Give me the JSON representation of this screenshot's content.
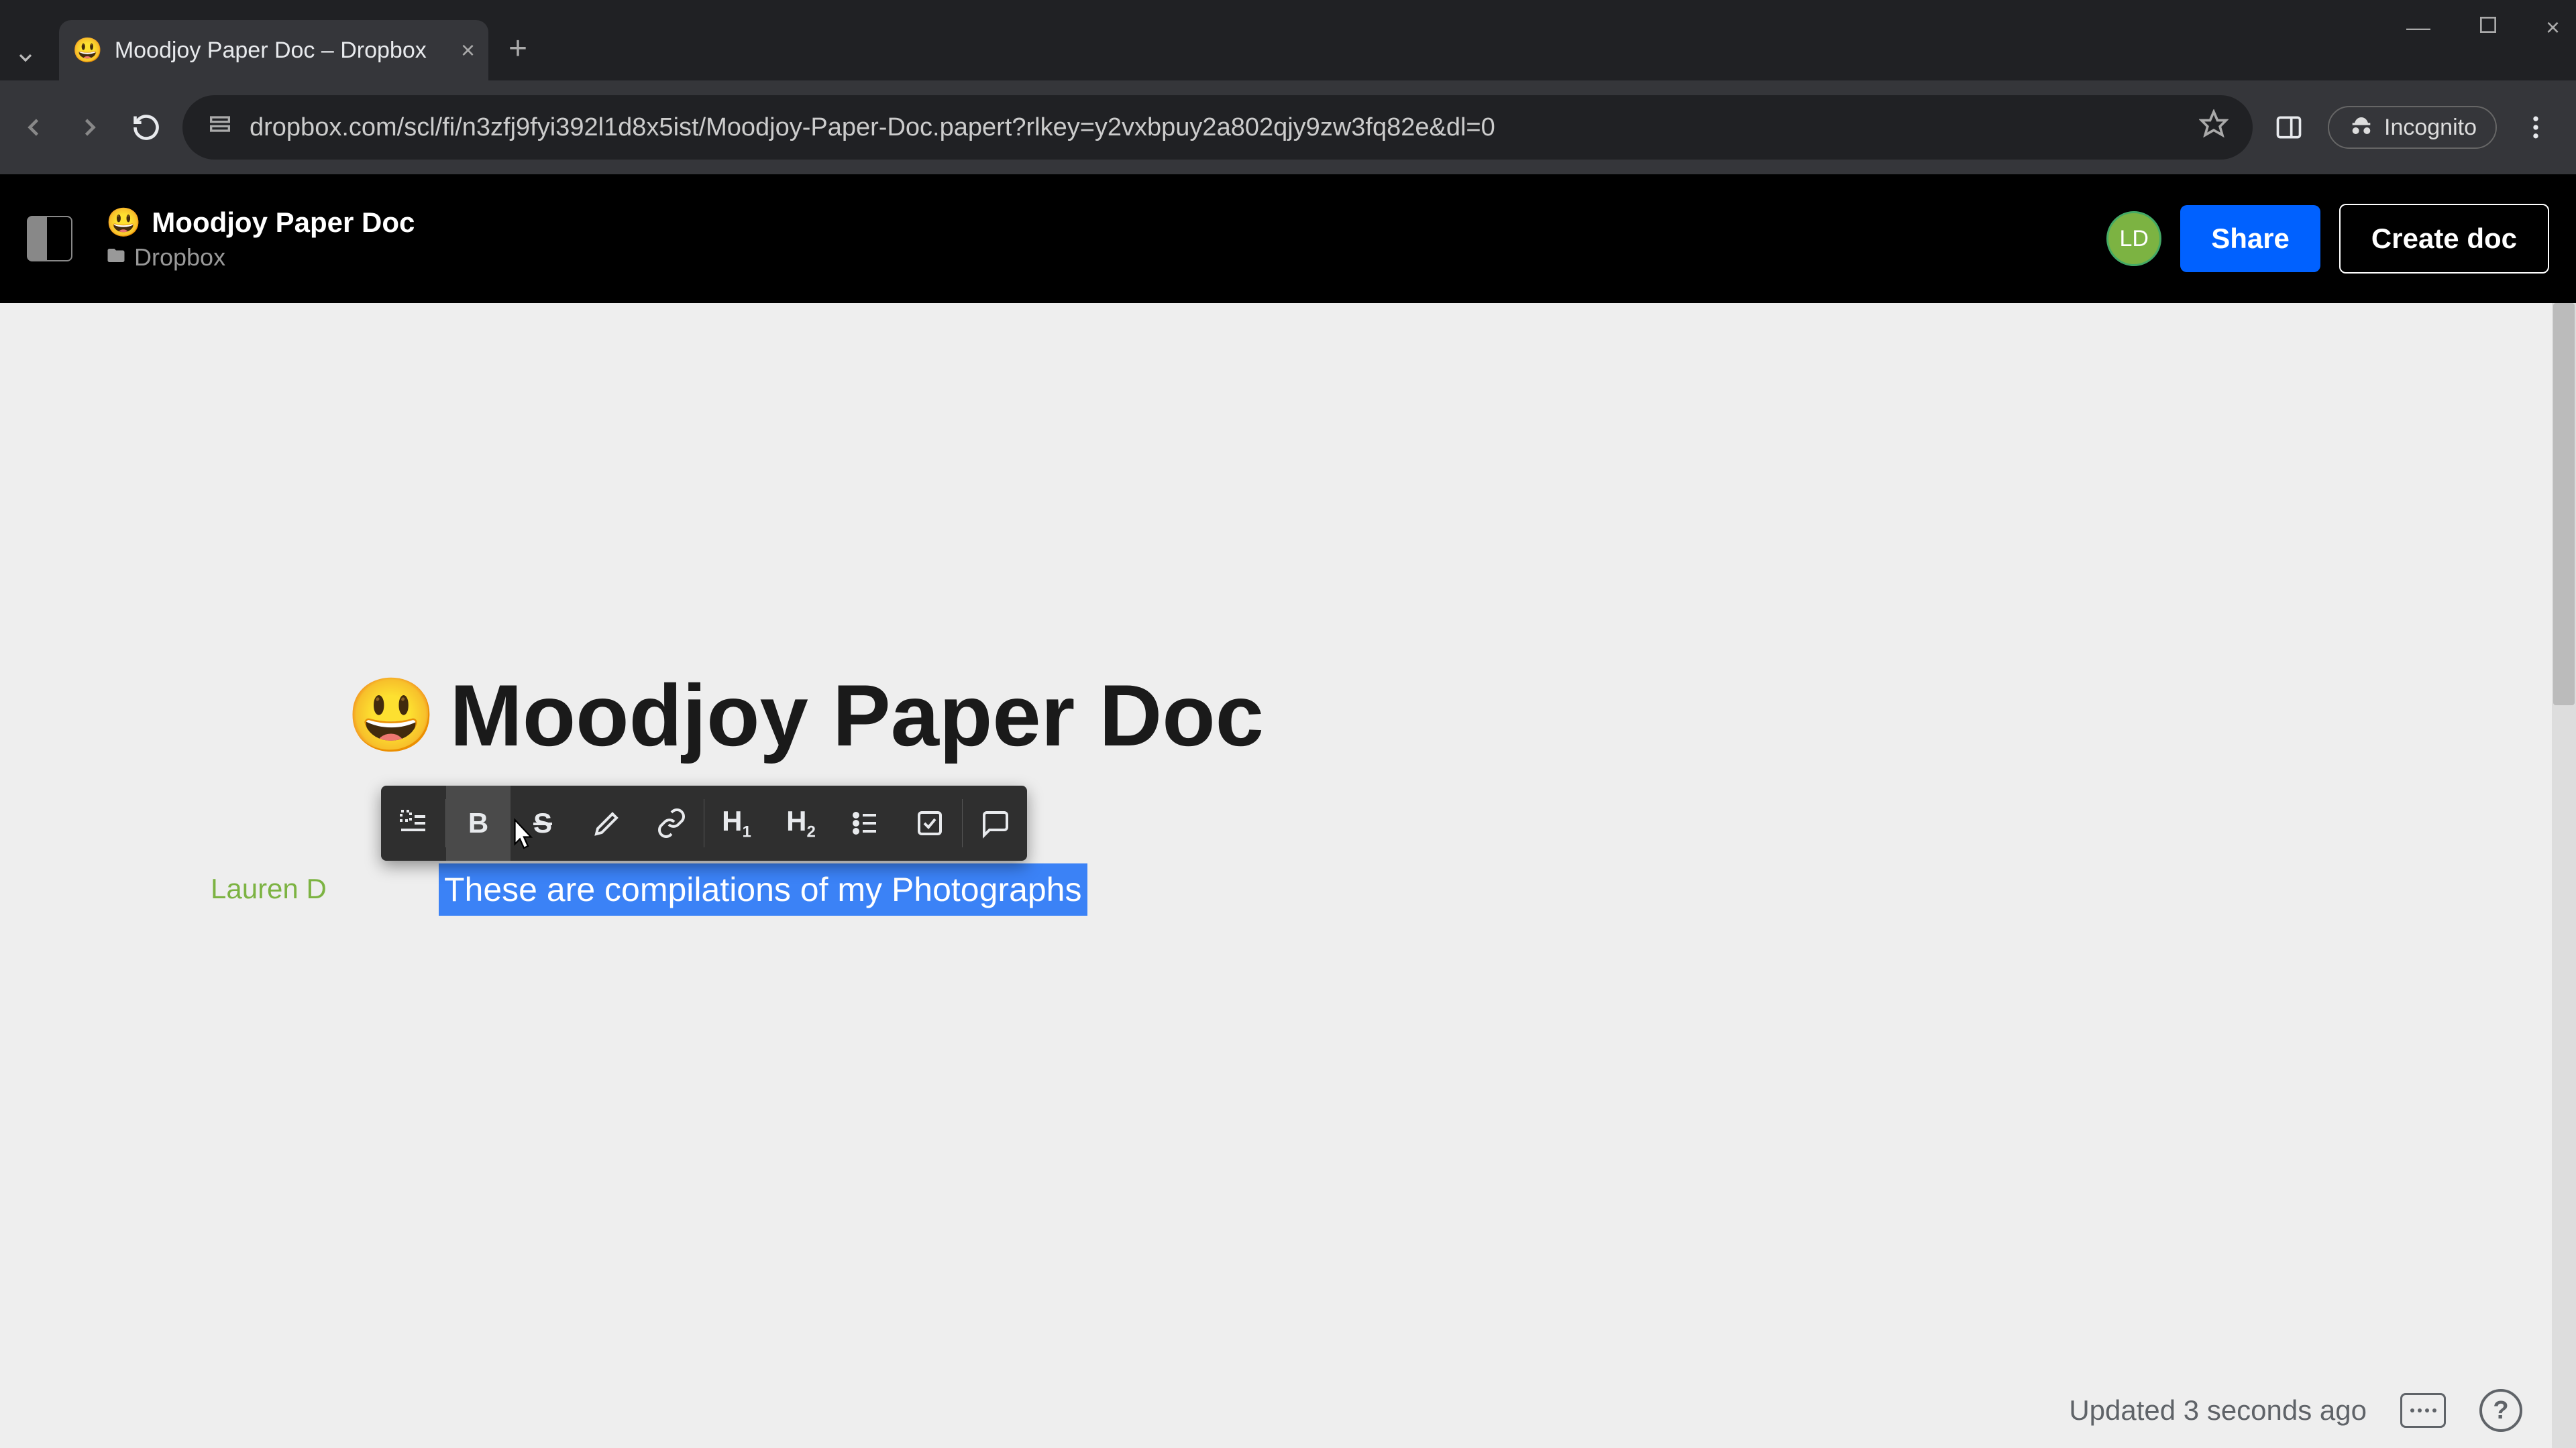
{
  "browser": {
    "tab_title": "Moodjoy Paper Doc – Dropbox",
    "url": "dropbox.com/scl/fi/n3zfj9fyi392l1d8x5ist/Moodjoy-Paper-Doc.papert?rlkey=y2vxbpuy2a802qjy9zw3fq82e&dl=0",
    "incognito_label": "Incognito"
  },
  "app_header": {
    "emoji": "😃",
    "doc_title": "Moodjoy Paper Doc",
    "breadcrumb": "Dropbox",
    "avatar_initials": "LD",
    "share_label": "Share",
    "create_label": "Create doc"
  },
  "document": {
    "title_emoji": "😃",
    "title": "Moodjoy Paper Doc",
    "author": "Lauren D",
    "selected_text": "These are compilations of my Photographs"
  },
  "toolbar": {
    "items": [
      {
        "name": "text-style-icon"
      },
      {
        "name": "bold-icon"
      },
      {
        "name": "strikethrough-icon"
      },
      {
        "name": "highlight-icon"
      },
      {
        "name": "link-icon"
      },
      {
        "name": "h1-icon",
        "label": "H",
        "sub": "1"
      },
      {
        "name": "h2-icon",
        "label": "H",
        "sub": "2"
      },
      {
        "name": "bullet-list-icon"
      },
      {
        "name": "checkbox-icon"
      },
      {
        "name": "comment-icon"
      }
    ]
  },
  "status": {
    "updated_text": "Updated 3 seconds ago"
  },
  "colors": {
    "accent": "#0061ff",
    "selection": "#3b82f6",
    "avatar": "#7cb342"
  }
}
